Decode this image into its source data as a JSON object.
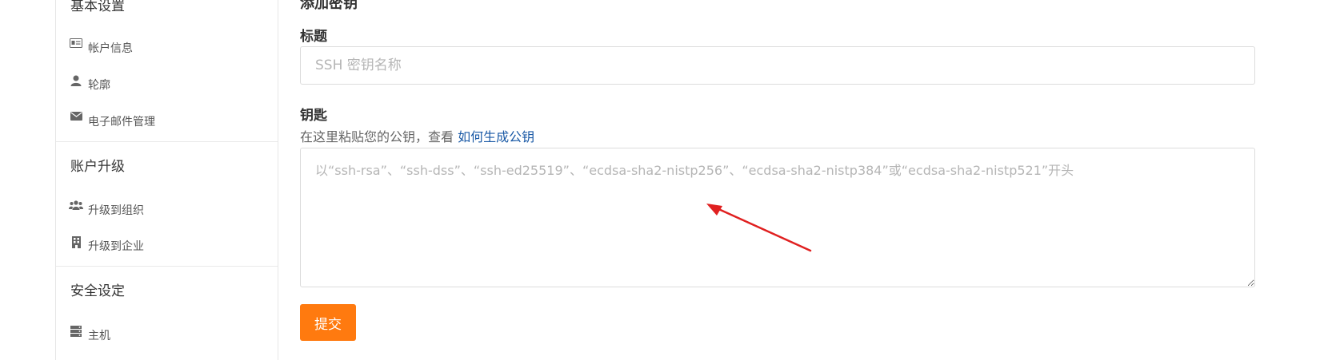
{
  "sidebar": {
    "sections": [
      {
        "heading": "基本设置",
        "items": [
          {
            "label": "帐户信息",
            "icon": "id-card-icon"
          },
          {
            "label": "轮廓",
            "icon": "user-icon"
          },
          {
            "label": "电子邮件管理",
            "icon": "envelope-icon"
          }
        ]
      },
      {
        "heading": "账户升级",
        "items": [
          {
            "label": "升级到组织",
            "icon": "users-icon"
          },
          {
            "label": "升级到企业",
            "icon": "building-icon"
          }
        ]
      },
      {
        "heading": "安全设定",
        "items": [
          {
            "label": "主机",
            "icon": "server-icon"
          }
        ]
      }
    ]
  },
  "form": {
    "section_title": "添加密钥",
    "title_label": "标题",
    "title_placeholder": "SSH 密钥名称",
    "title_value": "",
    "key_label": "钥匙",
    "key_help": "在这里粘贴您的公钥，查看",
    "key_help_link": "如何生成公钥",
    "key_placeholder": "以“ssh-rsa”、“ssh-dss”、“ssh-ed25519”、“ecdsa-sha2-nistp256”、“ecdsa-sha2-nistp384”或“ecdsa-sha2-nistp521”开头",
    "key_value": "",
    "submit_label": "提交"
  },
  "colors": {
    "accent": "#ff7a0f",
    "link": "#1b5aa6",
    "annotation_arrow": "#e02020"
  }
}
